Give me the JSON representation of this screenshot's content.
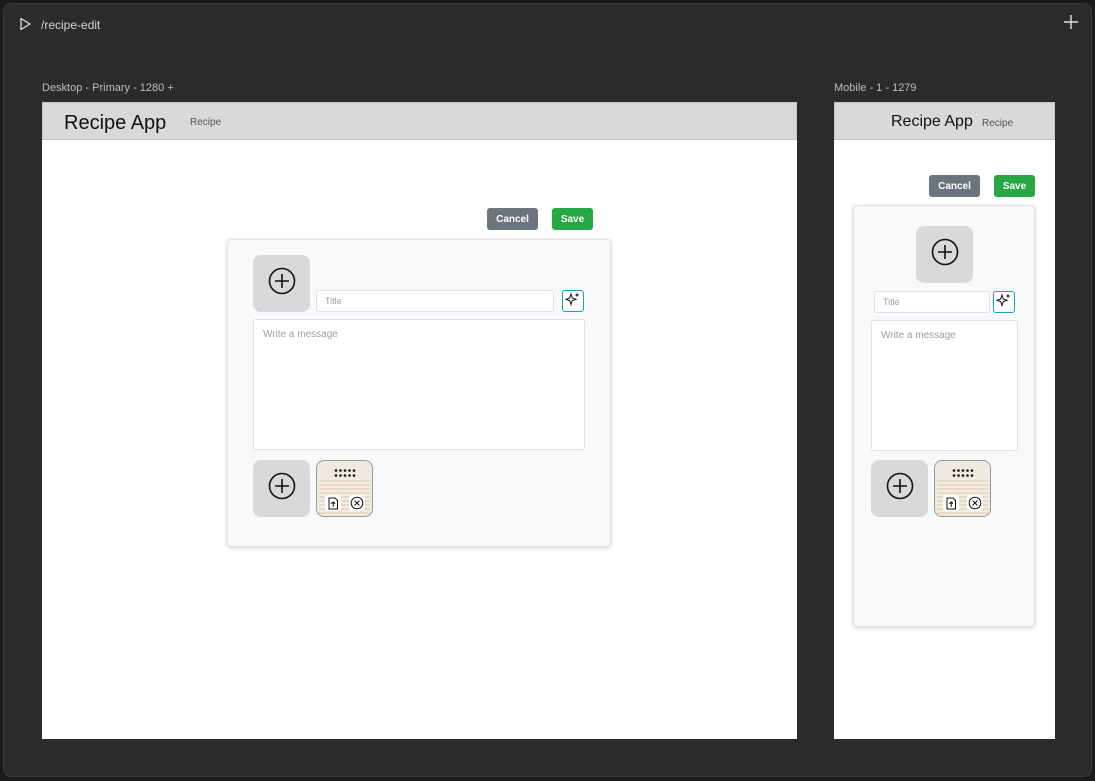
{
  "topbar": {
    "route": "/recipe-edit"
  },
  "frames": {
    "desktop": {
      "label": "Desktop - Primary - 1280 +"
    },
    "mobile": {
      "label": "Mobile - 1 - 1279"
    }
  },
  "app": {
    "title": "Recipe App",
    "subtitle": "Recipe"
  },
  "actions": {
    "cancel_label": "Cancel",
    "save_label": "Save"
  },
  "form": {
    "title_placeholder": "Title",
    "message_placeholder": "Write a message"
  },
  "colors": {
    "save": "#28a745",
    "cancel": "#6c757d",
    "ai_border": "#17a2b8",
    "header": "#d9d9d9"
  },
  "icons": {
    "add": "plus-circle-icon",
    "ai": "sparkles-icon",
    "upload": "file-upload-icon",
    "remove": "x-circle-icon",
    "drag": "drag-handle-icon",
    "run": "play-icon",
    "new": "plus-icon"
  }
}
